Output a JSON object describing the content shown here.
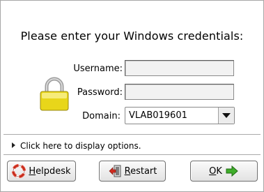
{
  "dialog": {
    "heading": "Please enter your Windows credentials:"
  },
  "form": {
    "username_label": "Username:",
    "username_value": "",
    "password_label": "Password:",
    "password_value": "",
    "domain_label": "Domain:",
    "domain_value": "VLAB019601"
  },
  "options": {
    "label": "Click here to display options."
  },
  "buttons": {
    "helpdesk_underlined": "H",
    "helpdesk_rest": "elpdesk",
    "restart_underlined": "R",
    "restart_rest": "estart",
    "ok_underlined": "O",
    "ok_rest": "K"
  },
  "icons": {
    "lock": "padlock-icon",
    "helpdesk": "lifebuoy-icon",
    "restart": "restart-icon",
    "ok": "green-arrow-right-icon"
  },
  "colors": {
    "lock_body": "#e8d61a",
    "lifebuoy_red": "#e23c2a",
    "ok_arrow": "#3fae2a",
    "restart_red": "#d12b1f"
  }
}
